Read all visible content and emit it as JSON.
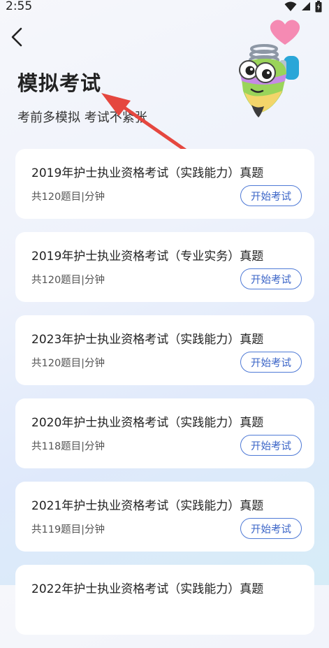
{
  "status": {
    "time": "2:55",
    "icons": [
      "wifi-icon",
      "signal-icon",
      "battery-icon"
    ]
  },
  "header": {
    "back_icon": "back-arrow-icon",
    "title": "模拟考试",
    "subtitle": "考前多模拟 考试不紧张"
  },
  "colors": {
    "accent": "#3a64c7",
    "arrow": "#e5473f",
    "card": "#ffffff"
  },
  "exams": [
    {
      "title": "2019年护士执业资格考试（实践能力）真题",
      "meta": "共120题目|分钟",
      "button": "开始考试"
    },
    {
      "title": "2019年护士执业资格考试（专业实务）真题",
      "meta": "共120题目|分钟",
      "button": "开始考试"
    },
    {
      "title": "2023年护士执业资格考试（实践能力）真题",
      "meta": "共120题目|分钟",
      "button": "开始考试"
    },
    {
      "title": "2020年护士执业资格考试（实践能力）真题",
      "meta": "共118题目|分钟",
      "button": "开始考试"
    },
    {
      "title": "2021年护士执业资格考试（实践能力）真题",
      "meta": "共119题目|分钟",
      "button": "开始考试"
    },
    {
      "title": "2022年护士执业资格考试（实践能力）真题",
      "meta": "",
      "button": ""
    }
  ]
}
